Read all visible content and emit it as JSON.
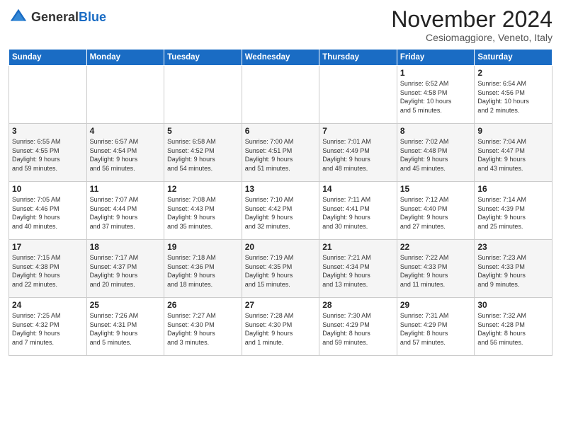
{
  "header": {
    "logo_general": "General",
    "logo_blue": "Blue",
    "title": "November 2024",
    "subtitle": "Cesiomaggiore, Veneto, Italy"
  },
  "weekdays": [
    "Sunday",
    "Monday",
    "Tuesday",
    "Wednesday",
    "Thursday",
    "Friday",
    "Saturday"
  ],
  "weeks": [
    [
      {
        "day": "",
        "detail": ""
      },
      {
        "day": "",
        "detail": ""
      },
      {
        "day": "",
        "detail": ""
      },
      {
        "day": "",
        "detail": ""
      },
      {
        "day": "",
        "detail": ""
      },
      {
        "day": "1",
        "detail": "Sunrise: 6:52 AM\nSunset: 4:58 PM\nDaylight: 10 hours\nand 5 minutes."
      },
      {
        "day": "2",
        "detail": "Sunrise: 6:54 AM\nSunset: 4:56 PM\nDaylight: 10 hours\nand 2 minutes."
      }
    ],
    [
      {
        "day": "3",
        "detail": "Sunrise: 6:55 AM\nSunset: 4:55 PM\nDaylight: 9 hours\nand 59 minutes."
      },
      {
        "day": "4",
        "detail": "Sunrise: 6:57 AM\nSunset: 4:54 PM\nDaylight: 9 hours\nand 56 minutes."
      },
      {
        "day": "5",
        "detail": "Sunrise: 6:58 AM\nSunset: 4:52 PM\nDaylight: 9 hours\nand 54 minutes."
      },
      {
        "day": "6",
        "detail": "Sunrise: 7:00 AM\nSunset: 4:51 PM\nDaylight: 9 hours\nand 51 minutes."
      },
      {
        "day": "7",
        "detail": "Sunrise: 7:01 AM\nSunset: 4:49 PM\nDaylight: 9 hours\nand 48 minutes."
      },
      {
        "day": "8",
        "detail": "Sunrise: 7:02 AM\nSunset: 4:48 PM\nDaylight: 9 hours\nand 45 minutes."
      },
      {
        "day": "9",
        "detail": "Sunrise: 7:04 AM\nSunset: 4:47 PM\nDaylight: 9 hours\nand 43 minutes."
      }
    ],
    [
      {
        "day": "10",
        "detail": "Sunrise: 7:05 AM\nSunset: 4:46 PM\nDaylight: 9 hours\nand 40 minutes."
      },
      {
        "day": "11",
        "detail": "Sunrise: 7:07 AM\nSunset: 4:44 PM\nDaylight: 9 hours\nand 37 minutes."
      },
      {
        "day": "12",
        "detail": "Sunrise: 7:08 AM\nSunset: 4:43 PM\nDaylight: 9 hours\nand 35 minutes."
      },
      {
        "day": "13",
        "detail": "Sunrise: 7:10 AM\nSunset: 4:42 PM\nDaylight: 9 hours\nand 32 minutes."
      },
      {
        "day": "14",
        "detail": "Sunrise: 7:11 AM\nSunset: 4:41 PM\nDaylight: 9 hours\nand 30 minutes."
      },
      {
        "day": "15",
        "detail": "Sunrise: 7:12 AM\nSunset: 4:40 PM\nDaylight: 9 hours\nand 27 minutes."
      },
      {
        "day": "16",
        "detail": "Sunrise: 7:14 AM\nSunset: 4:39 PM\nDaylight: 9 hours\nand 25 minutes."
      }
    ],
    [
      {
        "day": "17",
        "detail": "Sunrise: 7:15 AM\nSunset: 4:38 PM\nDaylight: 9 hours\nand 22 minutes."
      },
      {
        "day": "18",
        "detail": "Sunrise: 7:17 AM\nSunset: 4:37 PM\nDaylight: 9 hours\nand 20 minutes."
      },
      {
        "day": "19",
        "detail": "Sunrise: 7:18 AM\nSunset: 4:36 PM\nDaylight: 9 hours\nand 18 minutes."
      },
      {
        "day": "20",
        "detail": "Sunrise: 7:19 AM\nSunset: 4:35 PM\nDaylight: 9 hours\nand 15 minutes."
      },
      {
        "day": "21",
        "detail": "Sunrise: 7:21 AM\nSunset: 4:34 PM\nDaylight: 9 hours\nand 13 minutes."
      },
      {
        "day": "22",
        "detail": "Sunrise: 7:22 AM\nSunset: 4:33 PM\nDaylight: 9 hours\nand 11 minutes."
      },
      {
        "day": "23",
        "detail": "Sunrise: 7:23 AM\nSunset: 4:33 PM\nDaylight: 9 hours\nand 9 minutes."
      }
    ],
    [
      {
        "day": "24",
        "detail": "Sunrise: 7:25 AM\nSunset: 4:32 PM\nDaylight: 9 hours\nand 7 minutes."
      },
      {
        "day": "25",
        "detail": "Sunrise: 7:26 AM\nSunset: 4:31 PM\nDaylight: 9 hours\nand 5 minutes."
      },
      {
        "day": "26",
        "detail": "Sunrise: 7:27 AM\nSunset: 4:30 PM\nDaylight: 9 hours\nand 3 minutes."
      },
      {
        "day": "27",
        "detail": "Sunrise: 7:28 AM\nSunset: 4:30 PM\nDaylight: 9 hours\nand 1 minute."
      },
      {
        "day": "28",
        "detail": "Sunrise: 7:30 AM\nSunset: 4:29 PM\nDaylight: 8 hours\nand 59 minutes."
      },
      {
        "day": "29",
        "detail": "Sunrise: 7:31 AM\nSunset: 4:29 PM\nDaylight: 8 hours\nand 57 minutes."
      },
      {
        "day": "30",
        "detail": "Sunrise: 7:32 AM\nSunset: 4:28 PM\nDaylight: 8 hours\nand 56 minutes."
      }
    ]
  ]
}
